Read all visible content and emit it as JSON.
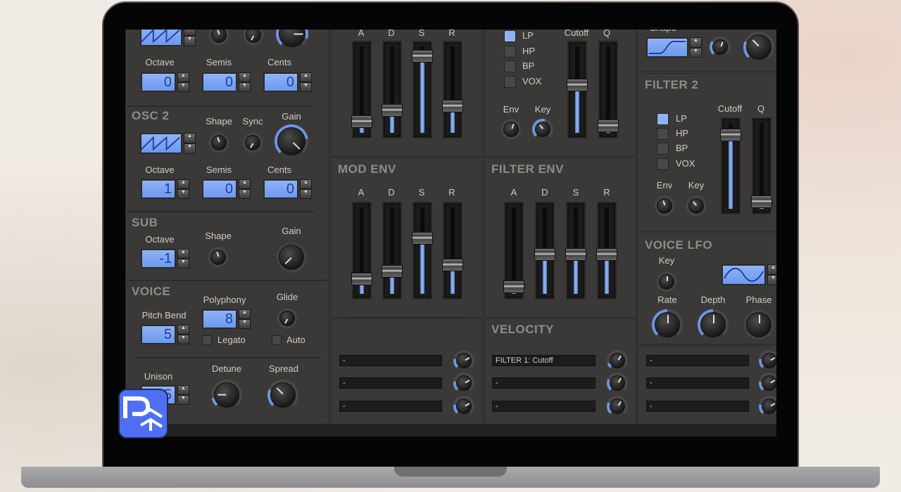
{
  "osc1": {
    "octave_label": "Octave",
    "semis_label": "Semis",
    "cents_label": "Cents",
    "octave": "0",
    "semis": "0",
    "cents": "0"
  },
  "osc2": {
    "title": "OSC 2",
    "shape_label": "Shape",
    "sync_label": "Sync",
    "gain_label": "Gain",
    "octave_label": "Octave",
    "semis_label": "Semis",
    "cents_label": "Cents",
    "octave": "1",
    "semis": "0",
    "cents": "0",
    "gain": 0.8
  },
  "sub": {
    "title": "SUB",
    "octave_label": "Octave",
    "octave": "-1",
    "shape_label": "Shape",
    "gain_label": "Gain"
  },
  "voice": {
    "title": "VOICE",
    "pitch_bend_label": "Pitch Bend",
    "pitch_bend": "5",
    "polyphony_label": "Polyphony",
    "polyphony": "8",
    "glide_label": "Glide",
    "legato_label": "Legato",
    "auto_label": "Auto",
    "unison_label": "Unison",
    "unison": "5",
    "detune_label": "Detune",
    "spread_label": "Spread"
  },
  "amp_env": {
    "labels": [
      "A",
      "D",
      "S",
      "R"
    ],
    "values": [
      0.1,
      0.25,
      0.95,
      0.3
    ]
  },
  "mod_env": {
    "title": "MOD ENV",
    "labels": [
      "A",
      "D",
      "S",
      "R"
    ],
    "values": [
      0.15,
      0.25,
      0.68,
      0.33
    ]
  },
  "filter1": {
    "types": [
      "LP",
      "HP",
      "BP",
      "VOX"
    ],
    "selected": "LP",
    "cutoff_label": "Cutoff",
    "q_label": "Q",
    "cutoff": 0.58,
    "q": 0.05,
    "env_label": "Env",
    "key_label": "Key"
  },
  "filter_env": {
    "title": "FILTER ENV",
    "labels": [
      "A",
      "D",
      "S",
      "R"
    ],
    "values": [
      0.05,
      0.47,
      0.47,
      0.47
    ]
  },
  "velocity": {
    "title": "VELOCITY",
    "slots": [
      "FILTER 1: Cutoff",
      "-",
      "-"
    ]
  },
  "mod_slots": [
    "-",
    "-",
    "-"
  ],
  "lfo_slots": [
    "-",
    "-",
    "-"
  ],
  "top_right": {
    "shape_label": "Shape"
  },
  "filter2": {
    "title": "FILTER 2",
    "types": [
      "LP",
      "HP",
      "BP",
      "VOX"
    ],
    "selected": "LP",
    "cutoff_label": "Cutoff",
    "q_label": "Q",
    "cutoff": 0.93,
    "q": 0.05,
    "env_label": "Env",
    "key_label": "Key"
  },
  "voice_lfo": {
    "title": "VOICE LFO",
    "key_label": "Key",
    "rate_label": "Rate",
    "depth_label": "Depth",
    "phase_label": "Phase"
  },
  "colors": {
    "lcd": "#8fb3f6",
    "accent": "#6d95e0",
    "panel": "#3b3937"
  }
}
